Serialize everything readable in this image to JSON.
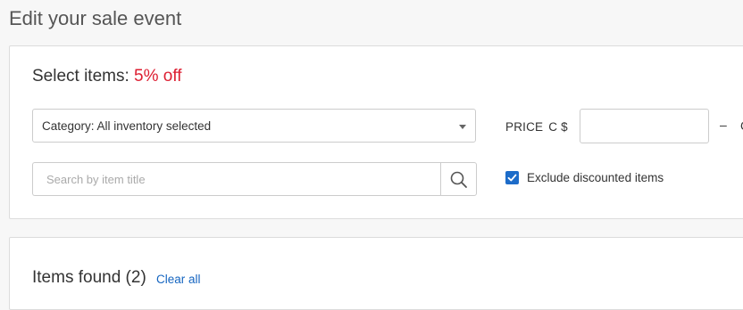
{
  "page": {
    "title": "Edit your sale event"
  },
  "select_items": {
    "title": "Select items:",
    "discount": "5% off",
    "category": {
      "selected": "Category: All inventory selected"
    },
    "search": {
      "placeholder": "Search by item title",
      "value": ""
    },
    "price": {
      "label": "PRICE",
      "currency": "C $",
      "min_value": "",
      "separator": "–",
      "max_currency_partial": "C"
    },
    "exclude_discounted": {
      "label": "Exclude discounted items",
      "checked": true
    }
  },
  "items_found": {
    "title": "Items found (2)",
    "clear_all": "Clear all"
  },
  "colors": {
    "discount": "#dd1e31",
    "link": "#1565c0",
    "checkbox": "#1d6cc9"
  },
  "icons": [
    "search-icon",
    "chevron-down-icon",
    "checkmark-icon"
  ]
}
